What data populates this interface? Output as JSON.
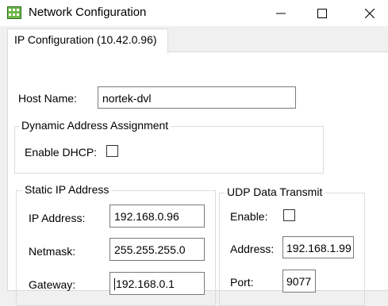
{
  "window": {
    "title": "Network Configuration",
    "controls": {
      "minimize": "minimize",
      "maximize": "maximize",
      "close": "close"
    }
  },
  "tabs": [
    {
      "label": "IP Configuration (10.42.0.96)",
      "selected": true
    }
  ],
  "host": {
    "label": "Host Name:",
    "value": "nortek-dvl"
  },
  "dhcp_group": {
    "title": "Dynamic Address Assignment",
    "enable_label": "Enable DHCP:",
    "enabled": false
  },
  "static_group": {
    "title": "Static IP Address",
    "ip_label": "IP Address:",
    "ip_value": "192.168.0.96",
    "netmask_label": "Netmask:",
    "netmask_value": "255.255.255.0",
    "gateway_label": "Gateway:",
    "gateway_value": "192.168.0.1"
  },
  "udp_group": {
    "title": "UDP Data Transmit",
    "enable_label": "Enable:",
    "enabled": false,
    "address_label": "Address:",
    "address_value": "192.168.1.99",
    "port_label": "Port:",
    "port_value": "9077"
  },
  "colors": {
    "titlebar_bg": "#ffffff",
    "window_bg": "#f0f0f0",
    "panel_bg": "#ffffff",
    "textbox_border": "#7a7a7a",
    "group_border": "#dcdcdc"
  }
}
